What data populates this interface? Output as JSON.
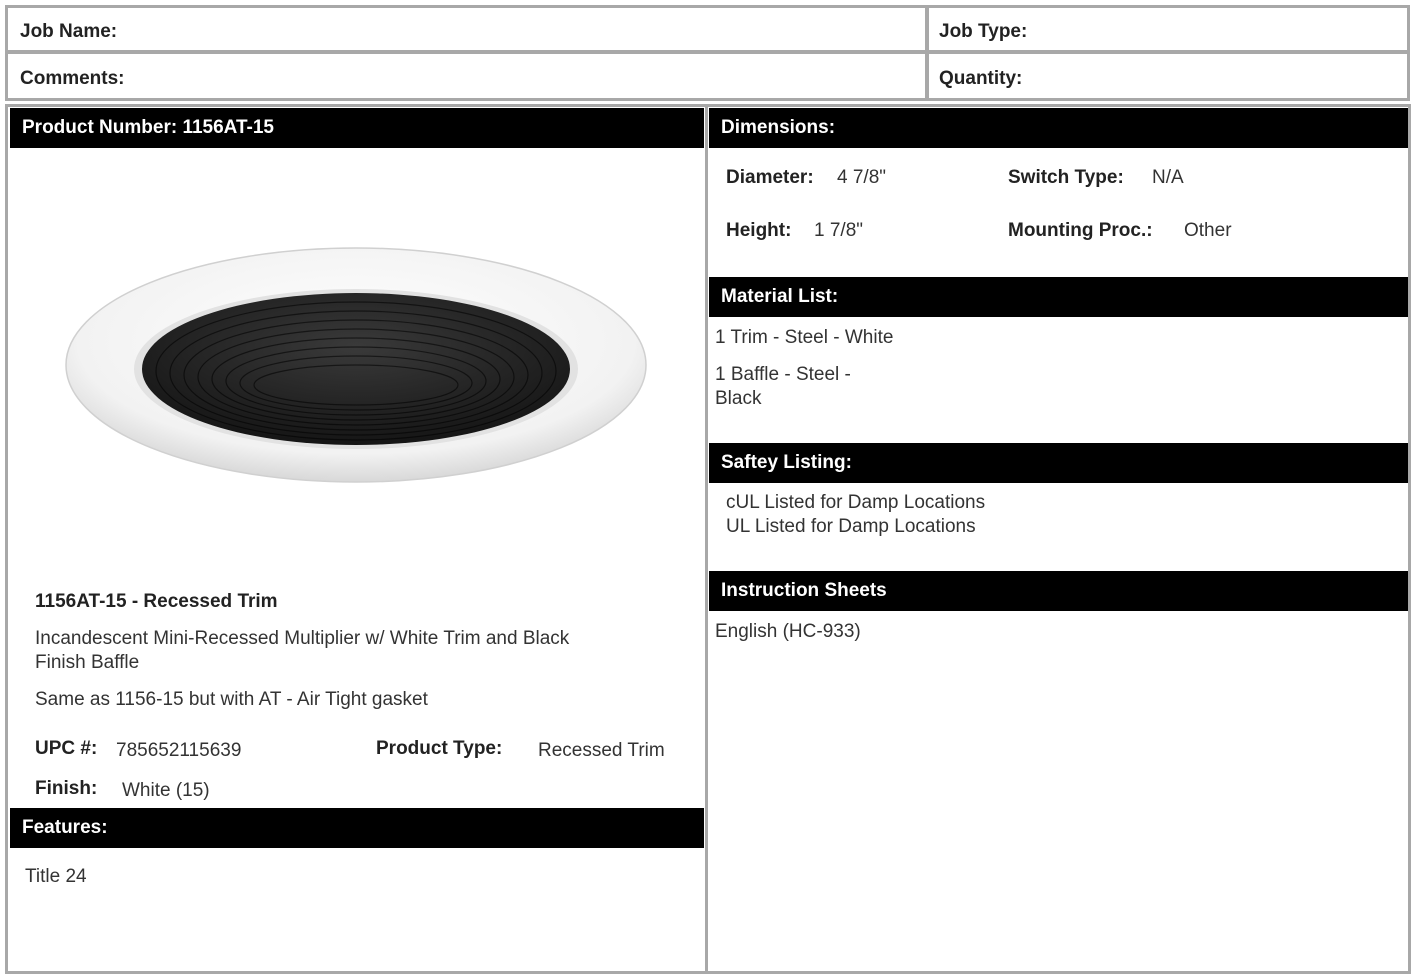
{
  "header": {
    "job_name_label": "Job Name:",
    "job_type_label": "Job Type:",
    "comments_label": "Comments:",
    "quantity_label": "Quantity:"
  },
  "left": {
    "product_number_header": "Product Number: 1156AT-15",
    "product_title": "1156AT-15 - Recessed Trim",
    "description_line1": "Incandescent Mini-Recessed Multiplier w/ White Trim and Black",
    "description_line2": "Finish Baffle",
    "note": "Same as 1156-15 but with AT - Air Tight gasket",
    "upc_label": "UPC #:",
    "upc_value": "785652115639",
    "product_type_label": "Product Type:",
    "product_type_value": "Recessed Trim",
    "finish_label": "Finish:",
    "finish_value": "White (15)",
    "features_header": "Features:",
    "features": [
      "Title 24"
    ]
  },
  "right": {
    "dimensions_header": "Dimensions:",
    "diameter_label": "Diameter:",
    "diameter_value": "4 7/8\"",
    "switch_type_label": "Switch Type:",
    "switch_type_value": "N/A",
    "height_label": "Height:",
    "height_value": "1 7/8\"",
    "mounting_label": "Mounting Proc.:",
    "mounting_value": "Other",
    "material_header": "Material List:",
    "material_1": "1 Trim - Steel - White",
    "material_2a": "1 Baffle - Steel -",
    "material_2b": "Black",
    "safety_header": "Saftey Listing:",
    "safety_1": "cUL Listed for Damp Locations",
    "safety_2": "UL Listed for Damp Locations",
    "instructions_header": "Instruction Sheets",
    "instructions_link": "English (HC-933)"
  },
  "colors": {
    "border": "#a8a8a8",
    "header_bar": "#000000",
    "header_text": "#ffffff"
  }
}
